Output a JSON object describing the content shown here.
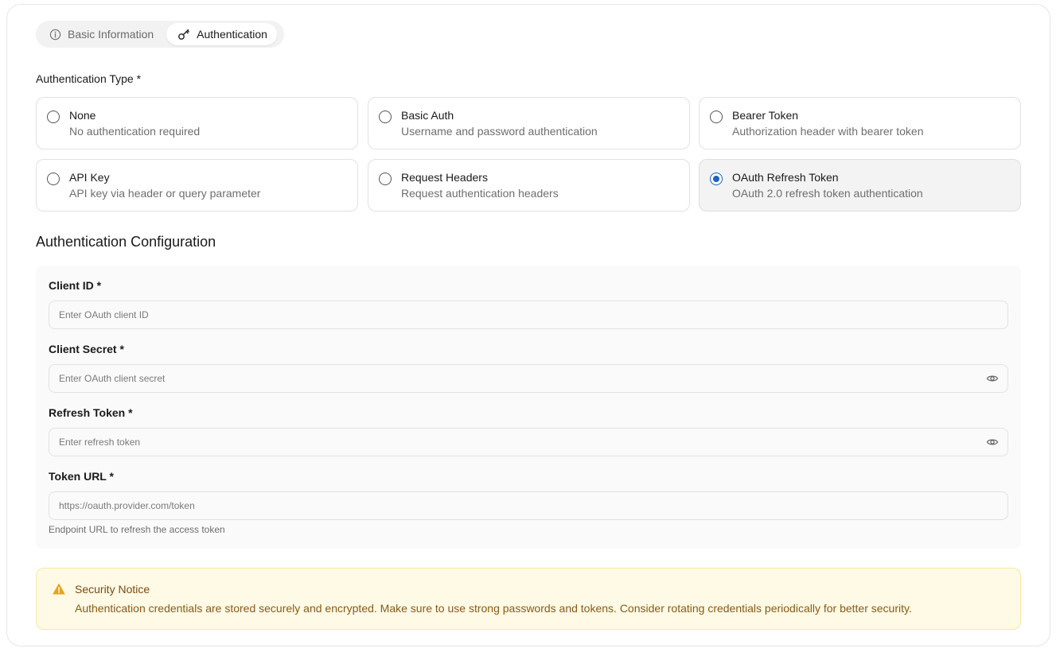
{
  "tabs": [
    {
      "label": "Basic Information",
      "icon": "info-icon",
      "active": false
    },
    {
      "label": "Authentication",
      "icon": "key-icon",
      "active": true
    }
  ],
  "auth_type": {
    "label": "Authentication Type *",
    "selected": "OAuth Refresh Token",
    "options": [
      {
        "title": "None",
        "description": "No authentication required"
      },
      {
        "title": "Basic Auth",
        "description": "Username and password authentication"
      },
      {
        "title": "Bearer Token",
        "description": "Authorization header with bearer token"
      },
      {
        "title": "API Key",
        "description": "API key via header or query parameter"
      },
      {
        "title": "Request Headers",
        "description": "Request authentication headers"
      },
      {
        "title": "OAuth Refresh Token",
        "description": "OAuth 2.0 refresh token authentication"
      }
    ]
  },
  "config": {
    "title": "Authentication Configuration",
    "client_id": {
      "label": "Client ID *",
      "placeholder": "Enter OAuth client ID",
      "value": ""
    },
    "client_secret": {
      "label": "Client Secret *",
      "placeholder": "Enter OAuth client secret",
      "value": "",
      "icon": "eye-icon"
    },
    "refresh_token": {
      "label": "Refresh Token *",
      "placeholder": "Enter refresh token",
      "value": "",
      "icon": "eye-icon"
    },
    "token_url": {
      "label": "Token URL *",
      "placeholder": "https://oauth.provider.com/token",
      "value": "",
      "hint": "Endpoint URL to refresh the access token"
    }
  },
  "notice": {
    "icon": "warning-icon",
    "title": "Security Notice",
    "text": "Authentication credentials are stored securely and encrypted. Make sure to use strong passwords and tokens. Consider rotating credentials periodically for better security."
  },
  "colors": {
    "accent": "#1a63c2",
    "notice_bg": "#fefae6",
    "notice_border": "#f6e8a6",
    "warning": "#e8a317"
  }
}
